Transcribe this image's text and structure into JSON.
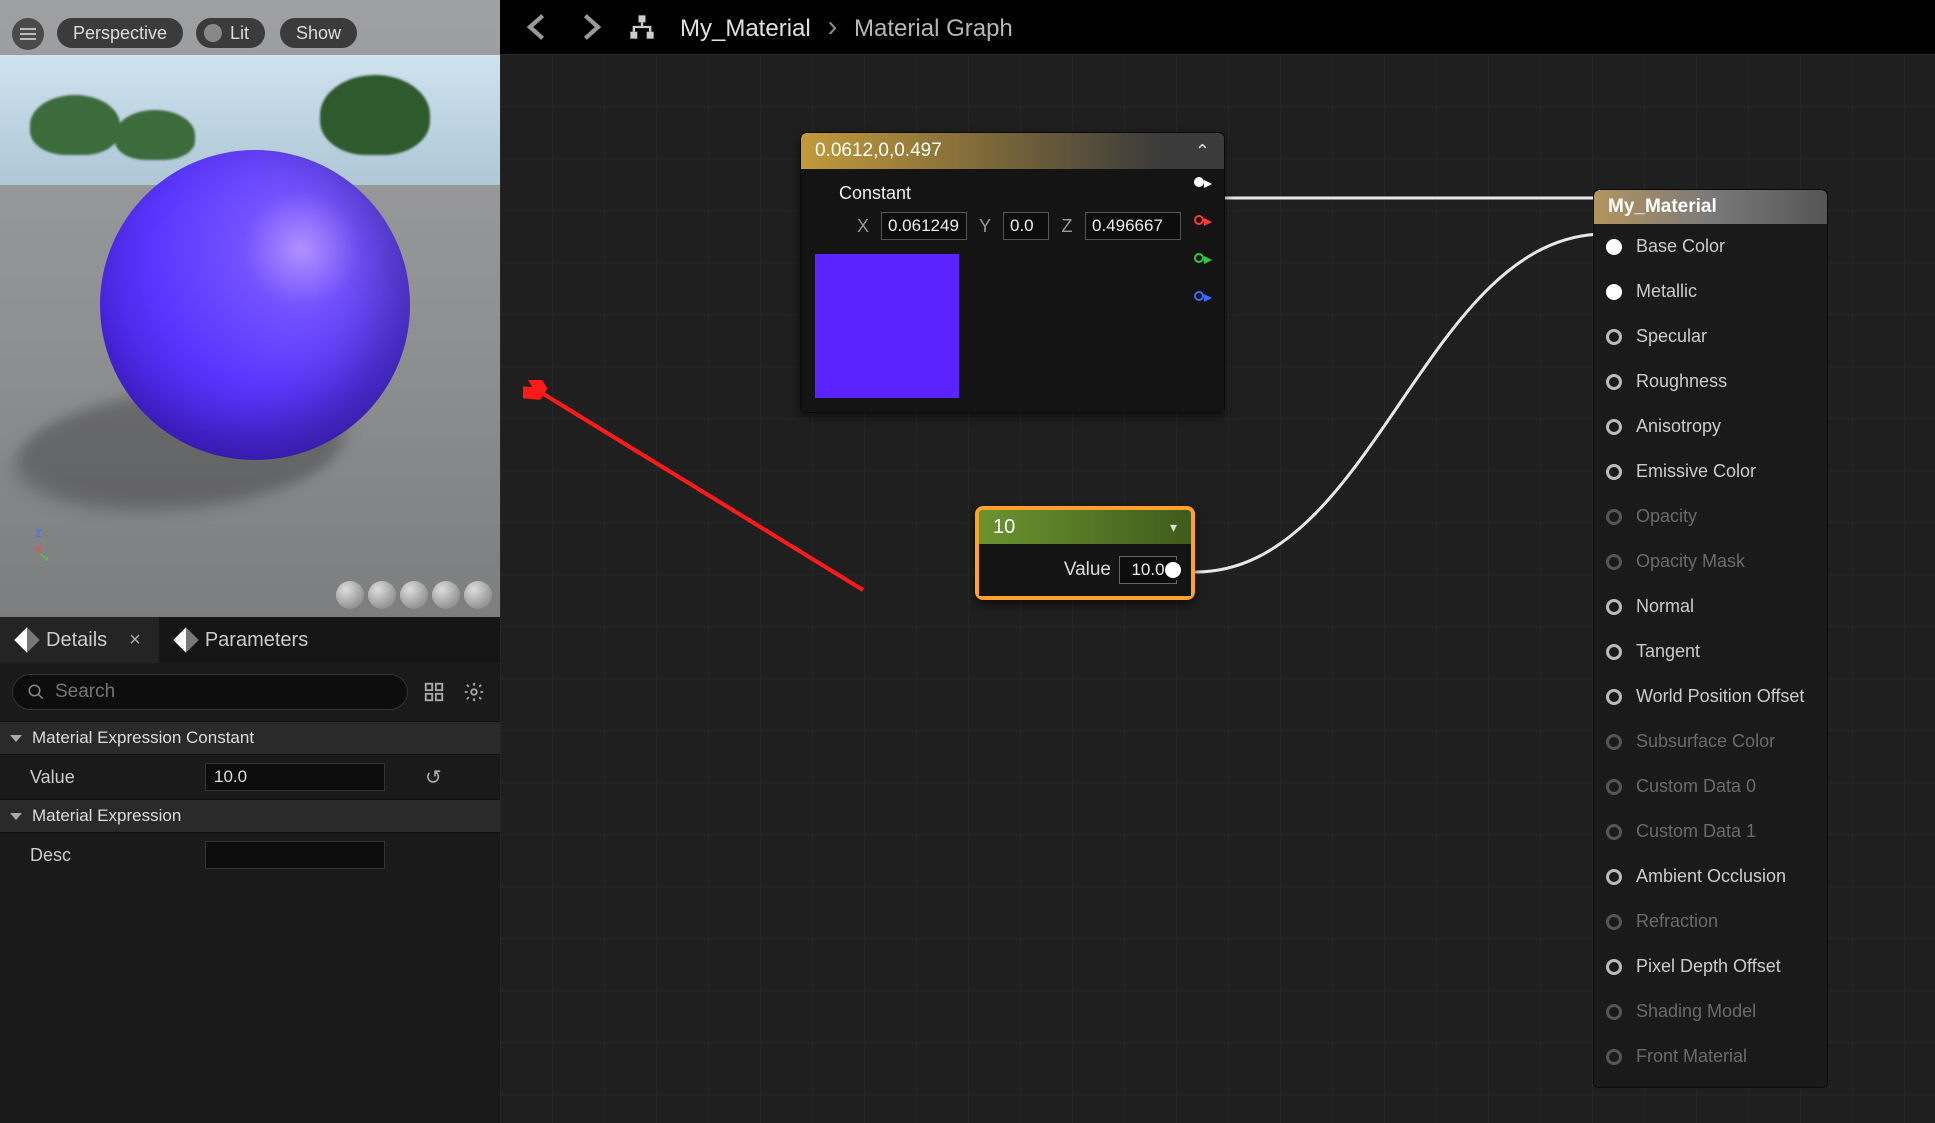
{
  "viewport": {
    "perspective": "Perspective",
    "lit": "Lit",
    "show": "Show"
  },
  "tabs": {
    "details": "Details",
    "parameters": "Parameters"
  },
  "search": {
    "placeholder": "Search"
  },
  "group1": {
    "title": "Material Expression Constant",
    "value_label": "Value",
    "value": "10.0"
  },
  "group2": {
    "title": "Material Expression",
    "desc_label": "Desc",
    "desc": ""
  },
  "breadcrumb": {
    "asset": "My_Material",
    "page": "Material Graph"
  },
  "constant3": {
    "title": "0.0612,0,0.497",
    "label": "Constant",
    "x": "0.061249",
    "y": "0.0",
    "z": "0.496667",
    "swatch_color": "#5a23ff"
  },
  "scalar": {
    "title": "10",
    "value_label": "Value",
    "value": "10.0"
  },
  "result": {
    "title": "My_Material",
    "pins": [
      {
        "label": "Base Color",
        "state": "filled",
        "disabled": false
      },
      {
        "label": "Metallic",
        "state": "filled",
        "disabled": false
      },
      {
        "label": "Specular",
        "state": "hollow",
        "disabled": false
      },
      {
        "label": "Roughness",
        "state": "hollow",
        "disabled": false
      },
      {
        "label": "Anisotropy",
        "state": "hollow",
        "disabled": false
      },
      {
        "label": "Emissive Color",
        "state": "hollow",
        "disabled": false
      },
      {
        "label": "Opacity",
        "state": "hollow",
        "disabled": true
      },
      {
        "label": "Opacity Mask",
        "state": "hollow",
        "disabled": true
      },
      {
        "label": "Normal",
        "state": "hollow",
        "disabled": false
      },
      {
        "label": "Tangent",
        "state": "hollow",
        "disabled": false
      },
      {
        "label": "World Position Offset",
        "state": "hollow",
        "disabled": false
      },
      {
        "label": "Subsurface Color",
        "state": "hollow",
        "disabled": true
      },
      {
        "label": "Custom Data 0",
        "state": "hollow",
        "disabled": true
      },
      {
        "label": "Custom Data 1",
        "state": "hollow",
        "disabled": true
      },
      {
        "label": "Ambient Occlusion",
        "state": "hollow",
        "disabled": false
      },
      {
        "label": "Refraction",
        "state": "hollow",
        "disabled": true
      },
      {
        "label": "Pixel Depth Offset",
        "state": "hollow",
        "disabled": false
      },
      {
        "label": "Shading Model",
        "state": "hollow",
        "disabled": true
      },
      {
        "label": "Front Material",
        "state": "hollow",
        "disabled": true
      }
    ]
  }
}
